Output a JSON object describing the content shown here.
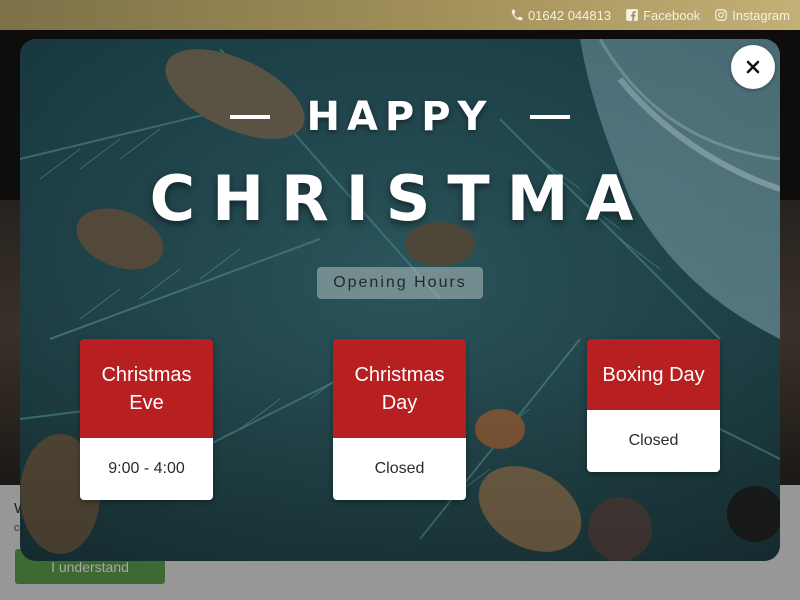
{
  "topbar": {
    "phone": "01642 044813",
    "facebook": "Facebook",
    "instagram": "Instagram"
  },
  "cookie": {
    "text_fragment": "W",
    "text_fragment_2": "c",
    "button_label": "I understand"
  },
  "modal": {
    "happy": "HAPPY",
    "title": "CHRISTMA",
    "subtitle": "Opening Hours",
    "days": [
      {
        "name": "Christmas Eve",
        "hours": "9:00 - 4:00"
      },
      {
        "name": "Christmas Day",
        "hours": "Closed"
      },
      {
        "name": "Boxing Day",
        "hours": "Closed"
      }
    ]
  },
  "colors": {
    "accent_red": "#b71f21",
    "gold": "#a19058",
    "cookie_button": "#5fa24f"
  },
  "icons": {
    "phone": "phone-icon",
    "facebook": "facebook-icon",
    "instagram": "instagram-icon",
    "close": "close-icon"
  }
}
